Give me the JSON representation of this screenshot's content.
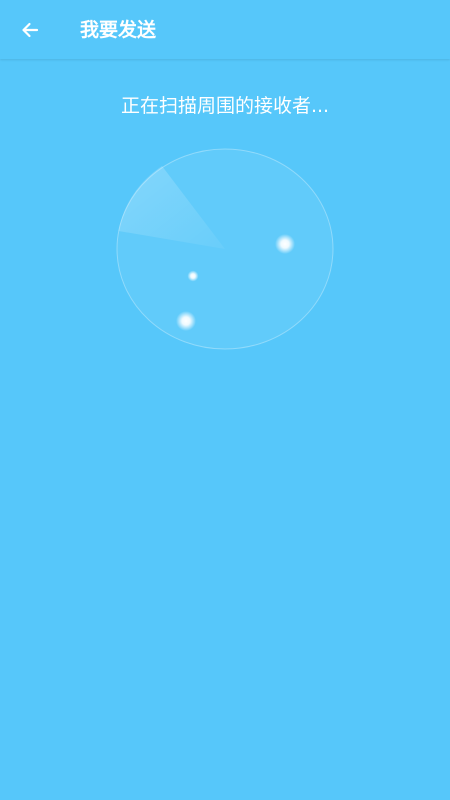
{
  "header": {
    "title": "我要发送",
    "back_icon": "arrow-left-icon"
  },
  "scan": {
    "status_text": "正在扫描周围的接收者...",
    "receivers_detected": 3
  },
  "colors": {
    "background": "#56c7fa",
    "text": "#ffffff"
  }
}
